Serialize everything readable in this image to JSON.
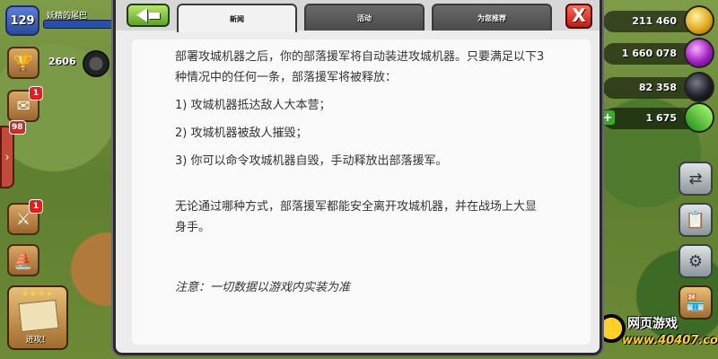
{
  "hud": {
    "level": "129",
    "player_name": "妖精的尾巴",
    "trophies": "2606",
    "mail_badge": "1",
    "side_tab_badge": "98",
    "side_tab_arrow": "›",
    "battle_badge": "1",
    "attack_label": "进攻！",
    "attack_stars": "★★★★",
    "resources": {
      "gold": "211 460",
      "elixir": "1 660 078",
      "dark_elixir": "82 358",
      "gems": "1 675",
      "gems_plus": "+"
    },
    "watermark": {
      "top": "网页游戏",
      "bottom": "www.40407.com"
    }
  },
  "modal": {
    "tabs": [
      {
        "label": "新闻",
        "active": true
      },
      {
        "label": "活动",
        "active": false
      },
      {
        "label": "为您推荐",
        "active": false
      }
    ],
    "close_label": "X",
    "paragraphs": {
      "intro": "部署攻城机器之后，你的部落援军将自动装进攻城机器。只要满足以下3种情况中的任何一条，部落援军将被释放：",
      "item1": "1) 攻城机器抵达敌人大本营；",
      "item2": "2) 攻城机器被敌人摧毁；",
      "item3": "3) 你可以命令攻城机器自毁，手动释放出部落援军。",
      "summary": "无论通过哪种方式，部落援军都能安全离开攻城机器，并在战场上大显身手。",
      "note": "注意：一切数据以游戏内实装为准"
    }
  }
}
